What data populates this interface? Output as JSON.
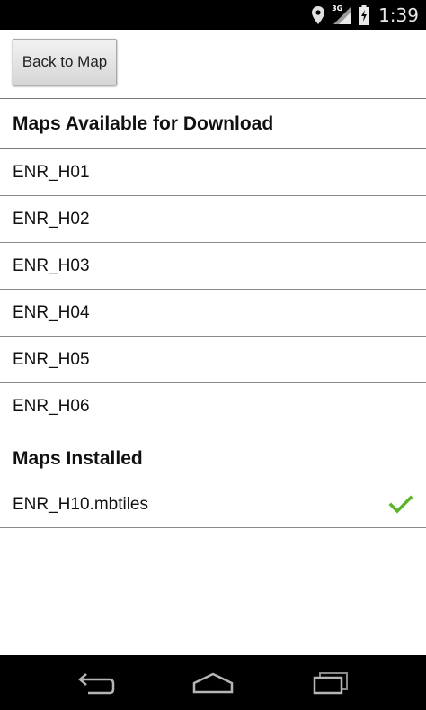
{
  "status_bar": {
    "network_label": "3G",
    "time": "1:39",
    "icons": [
      "location-pin-icon",
      "signal-icon",
      "battery-icon"
    ]
  },
  "toolbar": {
    "back_label": "Back to Map"
  },
  "available": {
    "title": "Maps Available for Download",
    "items": [
      {
        "label": "ENR_H01"
      },
      {
        "label": "ENR_H02"
      },
      {
        "label": "ENR_H03"
      },
      {
        "label": "ENR_H04"
      },
      {
        "label": "ENR_H05"
      },
      {
        "label": "ENR_H06"
      }
    ]
  },
  "installed": {
    "title": "Maps Installed",
    "items": [
      {
        "label": "ENR_H10.mbtiles",
        "status_icon": "checkmark-icon",
        "status_color": "#5bb52a"
      }
    ]
  },
  "nav_bar": {
    "buttons": [
      "back-icon",
      "home-icon",
      "recent-apps-icon"
    ]
  }
}
